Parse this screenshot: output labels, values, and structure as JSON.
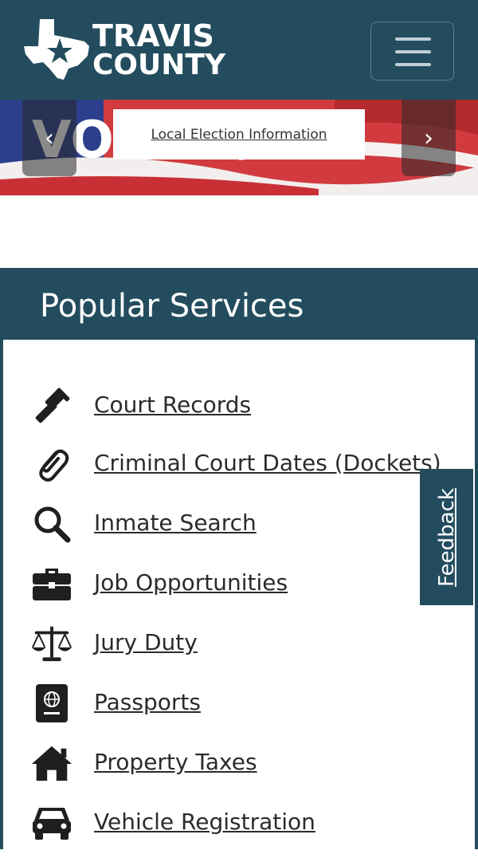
{
  "header": {
    "logo_line1": "TRAVIS",
    "logo_line2": "COUNTY",
    "menu_icon": "hamburger-menu-icon"
  },
  "banner": {
    "caption": "Local Election Information",
    "prev_icon": "chevron-left-icon",
    "next_icon": "chevron-right-icon",
    "prev_glyph": "‹",
    "next_glyph": "›"
  },
  "popular_services": {
    "title": "Popular Services",
    "items": [
      {
        "label": "Court Records",
        "icon": "gavel-icon"
      },
      {
        "label": "Criminal Court Dates (Dockets)",
        "icon": "paperclip-icon"
      },
      {
        "label": "Inmate Search",
        "icon": "search-icon"
      },
      {
        "label": "Job Opportunities",
        "icon": "briefcase-icon"
      },
      {
        "label": "Jury Duty",
        "icon": "scales-icon"
      },
      {
        "label": "Passports",
        "icon": "passport-icon"
      },
      {
        "label": "Property Taxes",
        "icon": "home-icon"
      },
      {
        "label": "Vehicle Registration",
        "icon": "car-icon"
      }
    ]
  },
  "feedback": {
    "label": "Feedback"
  },
  "colors": {
    "brand": "#234d5e",
    "text": "#2b2b2b",
    "background": "#ffffff"
  }
}
